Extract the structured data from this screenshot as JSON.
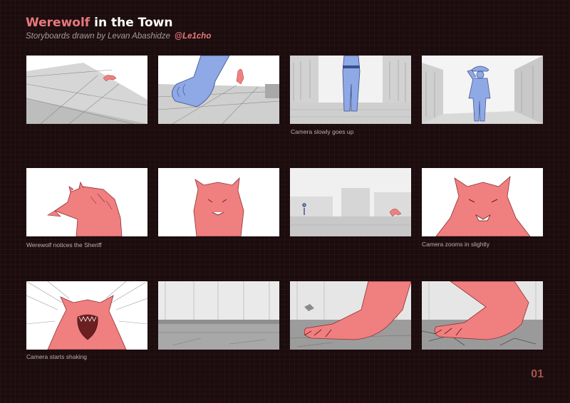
{
  "header": {
    "title_accent": "Werewolf",
    "title_rest": " in the Town",
    "subtitle": "Storyboards drawn by Levan Abashidze",
    "handle": "@Le1cho"
  },
  "colors": {
    "background": "#1c0c0e",
    "accent": "#e9797c",
    "werewolf": "#f07f80",
    "sheriff": "#8fa8e6"
  },
  "panels": [
    {
      "id": 1,
      "scene": "hill-werewolf-far",
      "caption": ""
    },
    {
      "id": 2,
      "scene": "sheriff-boot-foreground",
      "caption": ""
    },
    {
      "id": 3,
      "scene": "sheriff-street-legs",
      "caption": "Camera slowly goes up"
    },
    {
      "id": 4,
      "scene": "sheriff-full-body",
      "caption": ""
    },
    {
      "id": 5,
      "scene": "werewolf-profile",
      "caption": "Werewolf notices the Sheriff"
    },
    {
      "id": 6,
      "scene": "werewolf-front",
      "caption": ""
    },
    {
      "id": 7,
      "scene": "street-wide-shot",
      "caption": ""
    },
    {
      "id": 8,
      "scene": "werewolf-closeup",
      "caption": "Camera zooms in slightly"
    },
    {
      "id": 9,
      "scene": "werewolf-roar",
      "caption": "Camera starts shaking"
    },
    {
      "id": 10,
      "scene": "empty-street-ground",
      "caption": ""
    },
    {
      "id": 11,
      "scene": "werewolf-foot-landing",
      "caption": ""
    },
    {
      "id": 12,
      "scene": "werewolf-foot-cracks",
      "caption": ""
    }
  ],
  "page_number": "01"
}
